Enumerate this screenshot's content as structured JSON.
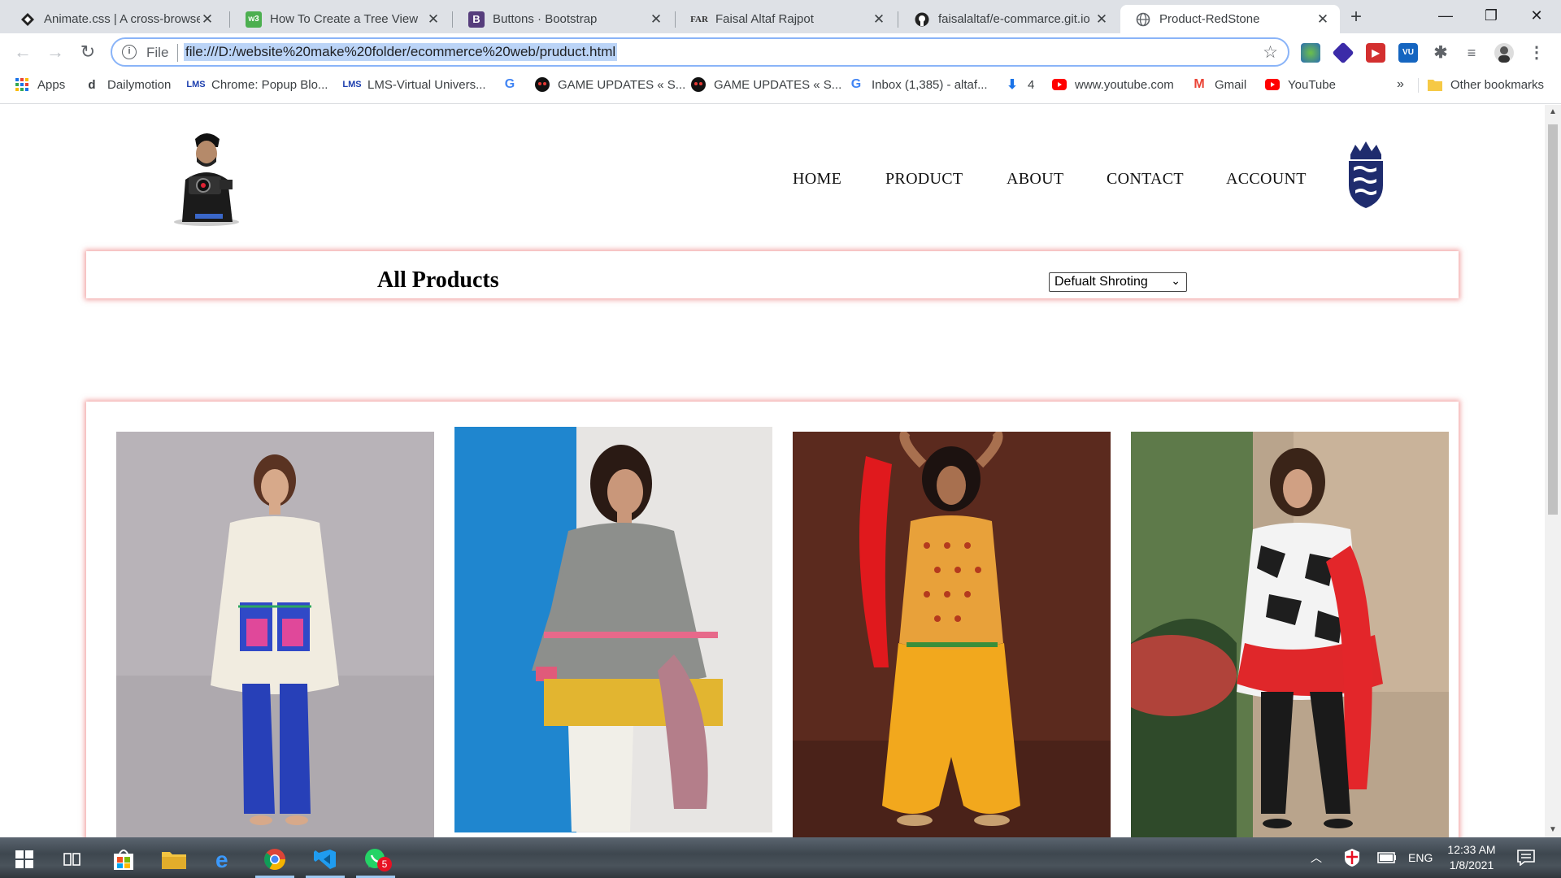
{
  "browser": {
    "tabs": [
      {
        "title": "Animate.css | A cross-browse",
        "icon": "animate-icon"
      },
      {
        "title": "How To Create a Tree View",
        "icon": "w3schools-icon"
      },
      {
        "title": "Buttons · Bootstrap",
        "icon": "bootstrap-icon"
      },
      {
        "title": "Faisal Altaf Rajpot",
        "icon": "far-logo-icon"
      },
      {
        "title": "faisalaltaf/e-commarce.git.io",
        "icon": "github-icon"
      },
      {
        "title": "Product-RedStone",
        "icon": "globe-icon",
        "active": true
      }
    ],
    "address": {
      "scheme": "File",
      "url": "file:///D:/website%20make%20folder/ecommerce%20web/pruduct.html"
    },
    "bookmarks": [
      {
        "label": "Apps",
        "icon": "apps-grid-icon"
      },
      {
        "label": "Dailymotion",
        "icon": "dailymotion-icon"
      },
      {
        "label": "Chrome: Popup Blo...",
        "icon": "lms-icon"
      },
      {
        "label": "LMS-Virtual Univers...",
        "icon": "lms-icon"
      },
      {
        "label": "",
        "icon": "google-icon"
      },
      {
        "label": "GAME UPDATES « S...",
        "icon": "game-icon"
      },
      {
        "label": "GAME UPDATES « S...",
        "icon": "game-icon"
      },
      {
        "label": "Inbox (1,385) - altaf...",
        "icon": "google-icon"
      },
      {
        "label": "4",
        "icon": "download-icon"
      },
      {
        "label": "www.youtube.com",
        "icon": "youtube-icon"
      },
      {
        "label": "Gmail",
        "icon": "gmail-icon"
      },
      {
        "label": "YouTube",
        "icon": "youtube-icon"
      }
    ],
    "bookmarks_overflow": "»",
    "other_bookmarks": "Other bookmarks"
  },
  "site": {
    "nav": [
      "HOME",
      "PRODUCT",
      "ABOUT",
      "CONTACT",
      "ACCOUNT"
    ],
    "heading": "All Products",
    "sort_selected": "Defualt Shroting"
  },
  "products": [
    {
      "name": "product-1",
      "bg": "#b7b2b6",
      "dress": "#f1ece0",
      "trousers": "#2740b8"
    },
    {
      "name": "product-2",
      "bg": "#1f86cf",
      "dress": "#8d8f8c",
      "trousers": "#f1efe8"
    },
    {
      "name": "product-3",
      "bg": "#5b2a1e",
      "dress": "#e8a13a",
      "trousers": "#f2a81d"
    },
    {
      "name": "product-4",
      "bg": "#b9a48c",
      "dress": "#2b2b2b",
      "trousers": "#1a1a1a"
    }
  ],
  "taskbar": {
    "whatsapp_badge": "5",
    "language": "ENG",
    "time": "12:33 AM",
    "date": "1/8/2021"
  },
  "colors": {
    "accent_shadow": "#e65a5a",
    "chrome_bg": "#dee1e6"
  }
}
